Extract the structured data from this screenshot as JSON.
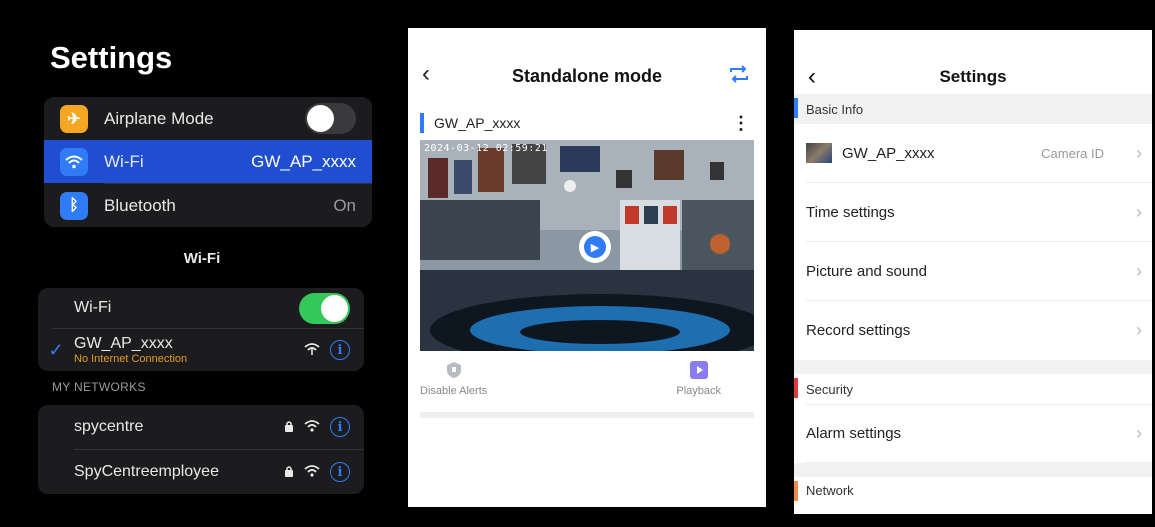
{
  "ios": {
    "title": "Settings",
    "top_rows": [
      {
        "label": "Airplane Mode",
        "icon": "airplane-icon",
        "color": "#f5a623",
        "toggle": "off"
      },
      {
        "label": "Wi-Fi",
        "icon": "wifi-icon",
        "color": "#2f7cf6",
        "value": "GW_AP_xxxx"
      },
      {
        "label": "Bluetooth",
        "icon": "bluetooth-icon",
        "color": "#2f7cf6",
        "value": "On"
      }
    ],
    "wifi_header": "Wi-Fi",
    "wifi_toggle_label": "Wi-Fi",
    "wifi_toggle_state": "on",
    "connected": {
      "name": "GW_AP_xxxx",
      "status": "No Internet Connection"
    },
    "my_networks_caption": "MY NETWORKS",
    "networks": [
      {
        "name": "spycentre"
      },
      {
        "name": "SpyCentreemployee"
      }
    ]
  },
  "standalone": {
    "title": "Standalone mode",
    "camera_name": "GW_AP_xxxx",
    "timestamp": "2024-03-12 02:59:21",
    "actions": [
      {
        "label": "Disable Alerts",
        "icon": "shield-icon"
      },
      {
        "label": "Playback",
        "icon": "playback-icon"
      }
    ],
    "accent": "#2f7cf6"
  },
  "settings": {
    "title": "Settings",
    "basic_info": "Basic Info",
    "camera": {
      "name": "GW_AP_xxxx",
      "value": "Camera ID"
    },
    "rows": [
      {
        "label": "Time settings"
      },
      {
        "label": "Picture and sound"
      },
      {
        "label": "Record settings"
      }
    ],
    "security": "Security",
    "alarm": "Alarm settings",
    "network": "Network",
    "section_colors": {
      "basic": "#2f7cf6",
      "security": "#e0393e",
      "network": "#f08a4b"
    }
  }
}
